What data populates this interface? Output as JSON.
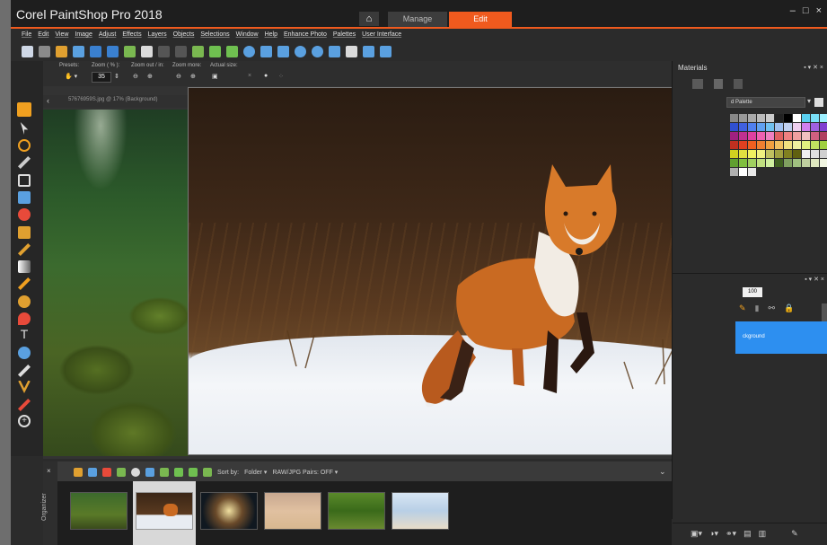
{
  "app": {
    "title": "Corel PaintShop Pro 2018",
    "home_icon": "home-icon",
    "tabs": [
      {
        "label": "Manage"
      },
      {
        "label": "Edit"
      }
    ],
    "window_controls": [
      "–",
      "□",
      "×"
    ]
  },
  "menu": [
    "File",
    "Edit",
    "View",
    "Image",
    "Adjust",
    "Effects",
    "Layers",
    "Objects",
    "Selections",
    "Window",
    "Help",
    "Enhance Photo",
    "Palettes",
    "User Interface"
  ],
  "tool_options": {
    "presets_label": "Presets:",
    "zoom_label": "Zoom ( % ):",
    "zoom_value": "35",
    "zoom_in_out_label": "Zoom out / in:",
    "zoom_more_label": "Zoom more:",
    "actual_size_label": "Actual size:"
  },
  "document": {
    "caption": "57676959S.jpg @ 17% (Background)"
  },
  "materials": {
    "title": "Materials",
    "palette_select": "d Palette",
    "panel_controls": "▪ ▾ ✕ ×"
  },
  "layers": {
    "opacity": "100",
    "layer_name": "ckground"
  },
  "organizer": {
    "label": "Organizer",
    "sort_label": "Sort by:",
    "sort_value": "Folder ▾",
    "raw_pairs": "RAW/JPG Pairs: OFF ▾",
    "thumbnails": [
      {
        "name": "forest-rocks"
      },
      {
        "name": "red-fox"
      },
      {
        "name": "sunlit-cave"
      },
      {
        "name": "desert-runner"
      },
      {
        "name": "jungle-path"
      },
      {
        "name": "beach-surfer"
      }
    ]
  },
  "colors": {
    "accent": "#f05a1e",
    "selection": "#2d8ff0",
    "tool_selected": "#f0a020"
  }
}
